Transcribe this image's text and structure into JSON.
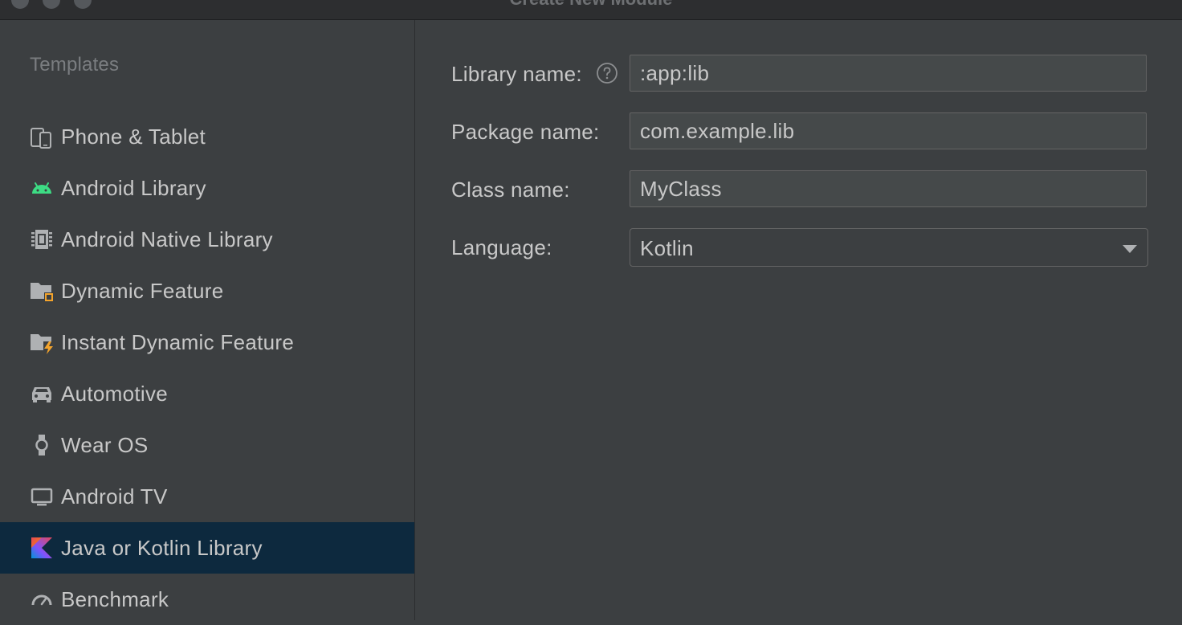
{
  "window": {
    "title": "Create New Module"
  },
  "sidebar": {
    "header": "Templates",
    "items": [
      {
        "label": "Phone & Tablet",
        "icon": "phone-tablet-icon"
      },
      {
        "label": "Android Library",
        "icon": "android-icon"
      },
      {
        "label": "Android Native Library",
        "icon": "chip-icon"
      },
      {
        "label": "Dynamic Feature",
        "icon": "folder-module-icon"
      },
      {
        "label": "Instant Dynamic Feature",
        "icon": "folder-lightning-icon"
      },
      {
        "label": "Automotive",
        "icon": "car-icon"
      },
      {
        "label": "Wear OS",
        "icon": "watch-icon"
      },
      {
        "label": "Android TV",
        "icon": "tv-icon"
      },
      {
        "label": "Java or Kotlin Library",
        "icon": "kotlin-icon",
        "selected": true
      },
      {
        "label": "Benchmark",
        "icon": "gauge-icon"
      }
    ]
  },
  "form": {
    "library_name": {
      "label": "Library name:",
      "value": ":app:lib"
    },
    "package_name": {
      "label": "Package name:",
      "value": "com.example.lib"
    },
    "class_name": {
      "label": "Class name:",
      "value": "MyClass"
    },
    "language": {
      "label": "Language:",
      "value": "Kotlin"
    }
  },
  "colors": {
    "background": "#3c3f41",
    "selection": "#0d293e",
    "field_bg": "#45494a",
    "border": "#646464",
    "android_green": "#3ddc84"
  }
}
